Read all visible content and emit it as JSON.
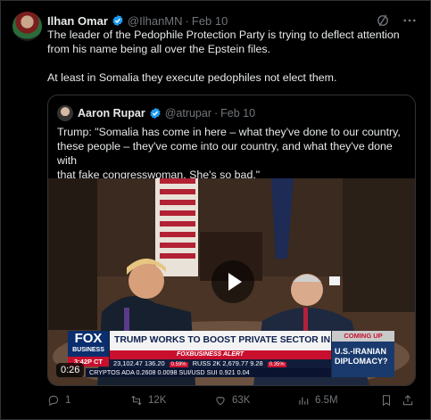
{
  "post": {
    "author_name": "Ilhan Omar",
    "handle": "@IlhanMN",
    "separator": "·",
    "date": "Feb 10",
    "text_lines": [
      "The leader of the Pedophile Protection Party is trying to deflect attention",
      "from his name being all over the Epstein files.",
      "At least in Somalia they execute pedophiles not elect them."
    ]
  },
  "quote": {
    "author_name": "Aaron Rupar",
    "handle": "@atrupar",
    "separator": "·",
    "date": "Feb 10",
    "text_lines": [
      "Trump: \"Somalia has come in here – what they've done to our country,",
      "these people – they've come into our country, and what they've done with",
      "that fake congresswoman. She's so bad.\""
    ],
    "video": {
      "duration": "0:26",
      "network": "FOX",
      "network_sub": "BUSINESS",
      "time": "3:42P CT",
      "headline": "TRUMP WORKS TO BOOST PRIVATE SECTOR IN SECOND TERM",
      "alert": "FOXBUSINESS ALERT",
      "ticker": [
        "23,102.47",
        "136.20",
        "0.59%",
        "RUSS 2K",
        "2,679.77",
        "9.28",
        "0.35%"
      ],
      "ticker2": [
        "CRYPTOS",
        "ADA",
        "0.2608",
        "0.0098",
        "SUI/USD",
        "SUI",
        "0.921",
        "0.04"
      ],
      "coming_up": "COMING UP",
      "next_story": [
        "U.S.-IRANIAN",
        "DIPLOMACY?"
      ]
    }
  },
  "actions": {
    "replies": "1",
    "reposts": "12K",
    "likes": "63K",
    "views": "6.5M"
  },
  "colors": {
    "accent": "#1d9bf0",
    "muted": "#71767b",
    "text": "#e7e9ea",
    "border": "#2f3336"
  }
}
